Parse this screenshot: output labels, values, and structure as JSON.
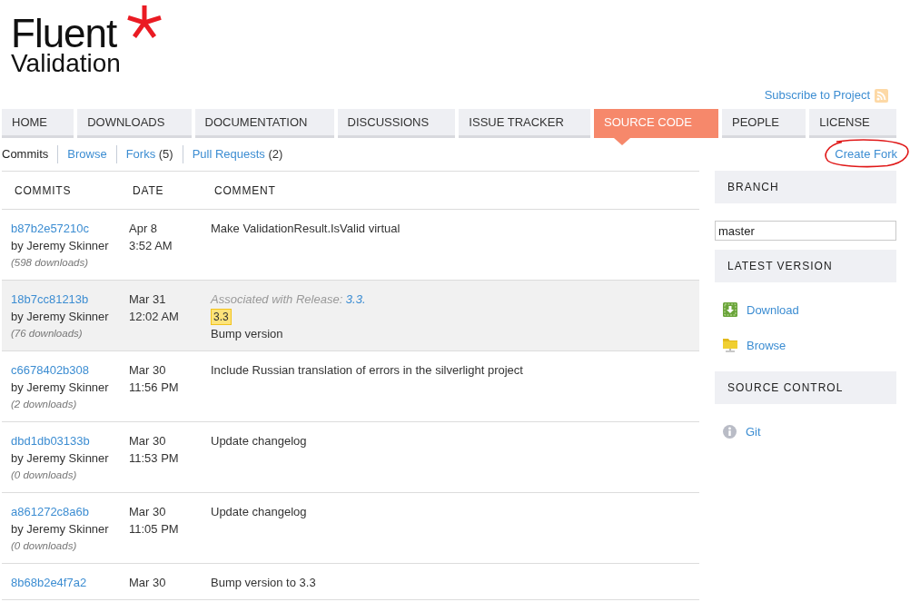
{
  "logo": {
    "title": "Fluent",
    "subtitle": "Validation"
  },
  "subscribe": {
    "label": "Subscribe to Project"
  },
  "tabs": [
    {
      "label": "HOME",
      "selected": false
    },
    {
      "label": "DOWNLOADS",
      "selected": false
    },
    {
      "label": "DOCUMENTATION",
      "selected": false
    },
    {
      "label": "DISCUSSIONS",
      "selected": false
    },
    {
      "label": "ISSUE TRACKER",
      "selected": false
    },
    {
      "label": "SOURCE CODE",
      "selected": true
    },
    {
      "label": "PEOPLE",
      "selected": false
    },
    {
      "label": "LICENSE",
      "selected": false
    }
  ],
  "subnav": {
    "links": [
      {
        "label": "Commits",
        "selected": true
      },
      {
        "label": "Browse",
        "selected": false
      },
      {
        "label": "Forks",
        "count": "(5)",
        "selected": false
      },
      {
        "label": "Pull Requests",
        "count": "(2)",
        "selected": false
      }
    ],
    "create_fork": {
      "label": "Create Fork",
      "circled": true
    }
  },
  "table": {
    "columns": [
      "COMMITS",
      "DATE",
      "COMMENT"
    ],
    "rows": [
      {
        "commit": "b87b2e57210c",
        "author": "by Jeremy Skinner",
        "downloads": "(598 downloads)",
        "date": "Apr 8",
        "time": "3:52 AM",
        "comment": "Make ValidationResult.IsValid virtual",
        "highlighted": false
      },
      {
        "commit": "18b7cc81213b",
        "author": "by Jeremy Skinner",
        "downloads": "(76 downloads)",
        "date": "Mar 31",
        "time": "12:02 AM",
        "release": {
          "label": "Associated with Release:",
          "link": "3.3.",
          "tag": "3.3"
        },
        "comment": "Bump version",
        "highlighted": true
      },
      {
        "commit": "c6678402b308",
        "author": "by Jeremy Skinner",
        "downloads": "(2 downloads)",
        "date": "Mar 30",
        "time": "11:56 PM",
        "comment": "Include Russian translation of errors in the silverlight project",
        "highlighted": false
      },
      {
        "commit": "dbd1db03133b",
        "author": "by Jeremy Skinner",
        "downloads": "(0 downloads)",
        "date": "Mar 30",
        "time": "11:53 PM",
        "comment": "Update changelog",
        "highlighted": false
      },
      {
        "commit": "a861272c8a6b",
        "author": "by Jeremy Skinner",
        "downloads": "(0 downloads)",
        "date": "Mar 30",
        "time": "11:05 PM",
        "comment": "Update changelog",
        "highlighted": false
      },
      {
        "commit": "8b68b2e4f7a2",
        "date": "Mar 30",
        "comment": "Bump version to 3.3",
        "highlighted": false
      }
    ]
  },
  "sidebar": {
    "sections": [
      {
        "kind": "field",
        "title": "BRANCH",
        "value": "master"
      },
      {
        "kind": "links",
        "title": "LATEST VERSION",
        "links": [
          {
            "kind": "download",
            "label": "Download"
          },
          {
            "kind": "browse",
            "label": "Browse"
          }
        ]
      },
      {
        "kind": "links",
        "title": "SOURCE CONTROL",
        "links": [
          {
            "kind": "scm",
            "label": "Git"
          }
        ]
      }
    ]
  }
}
